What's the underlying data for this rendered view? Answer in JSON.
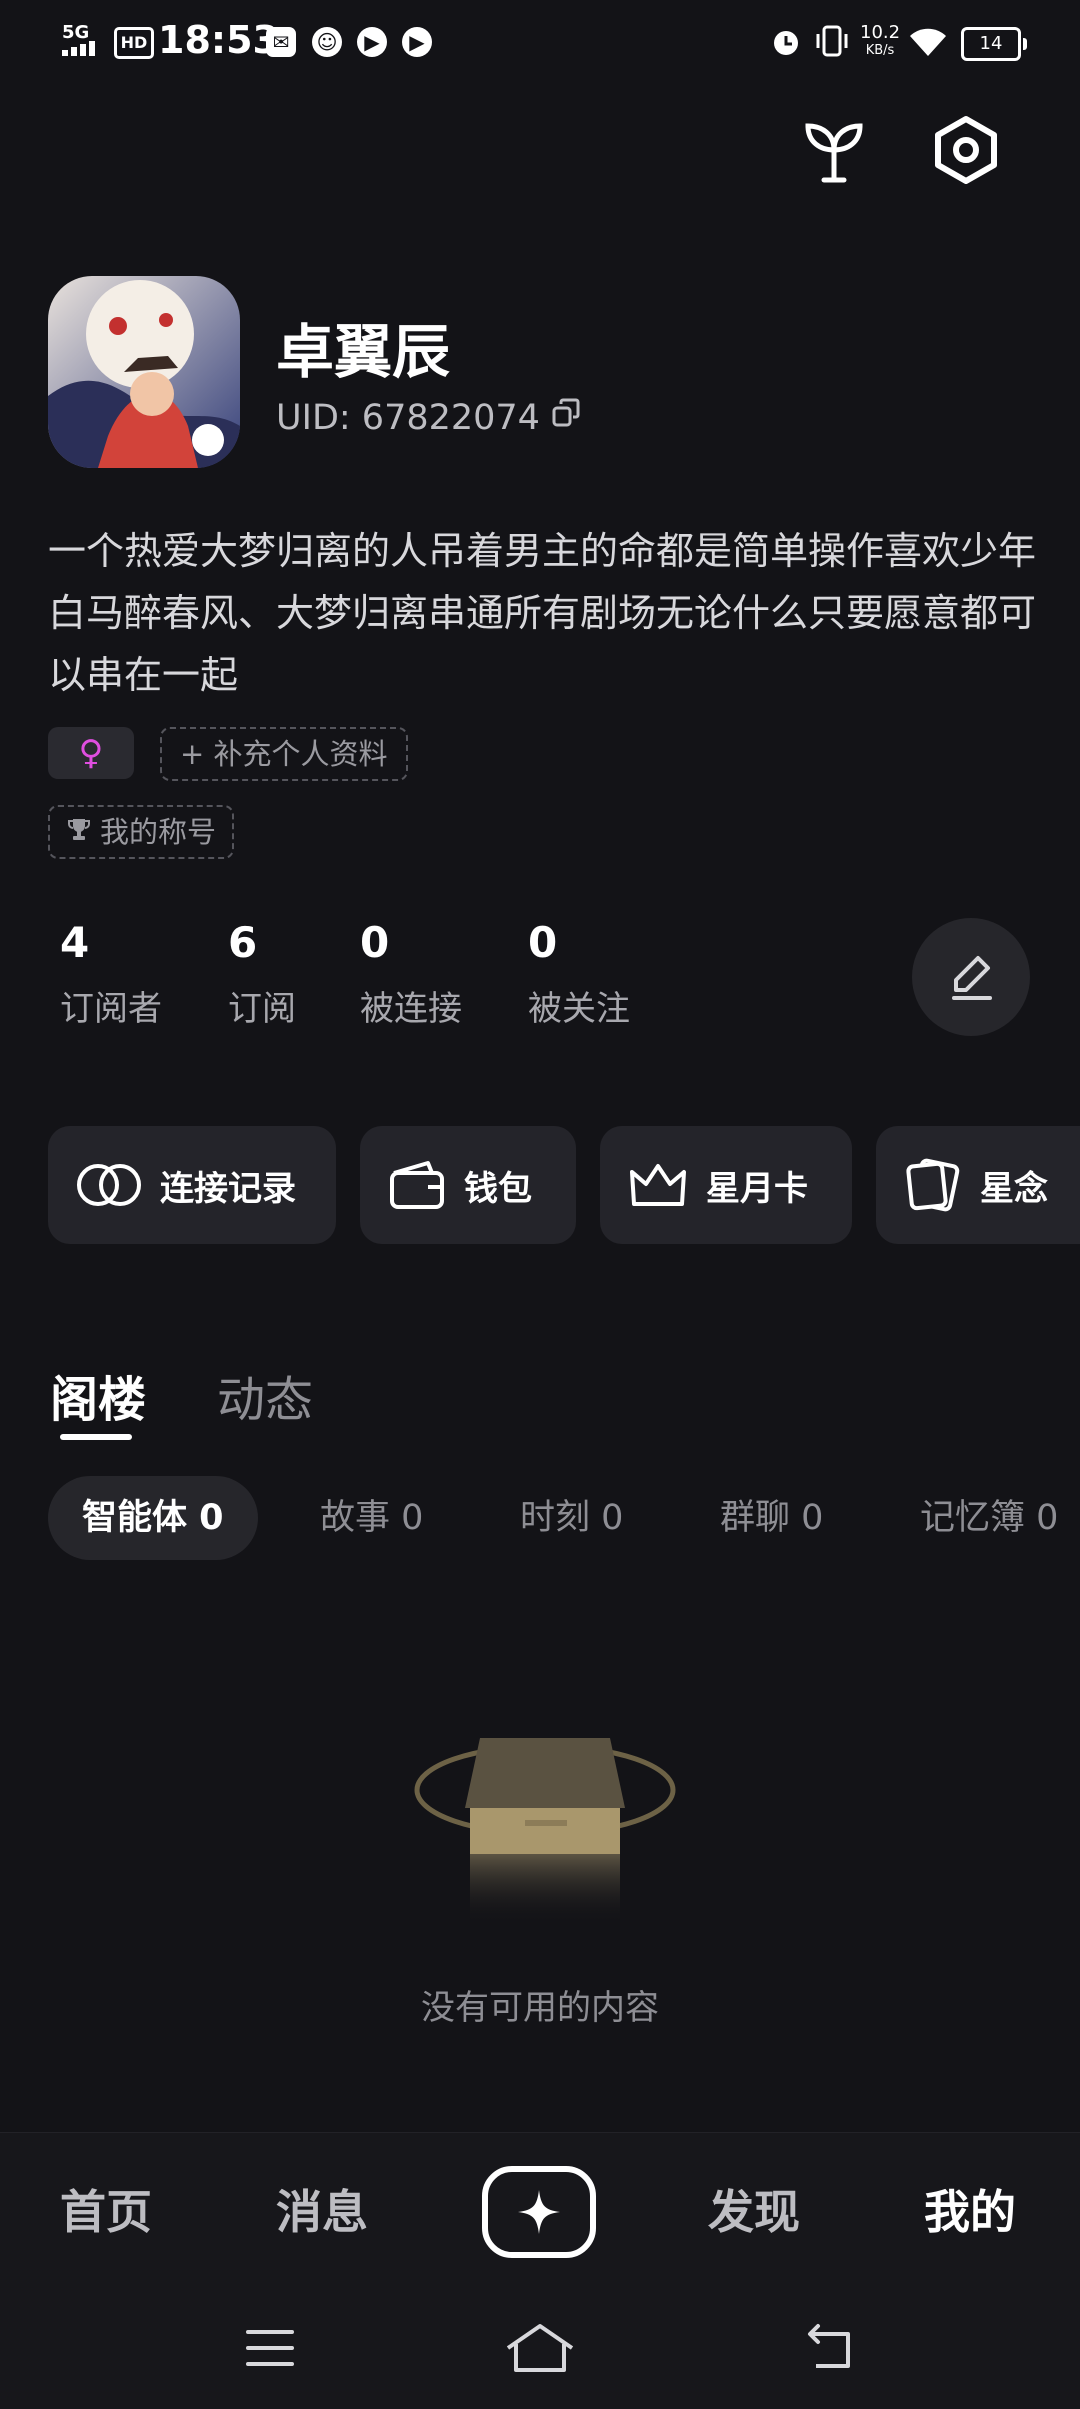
{
  "status": {
    "network": "5G",
    "hd": "HD",
    "time": "18:53",
    "speed_value": "10.2",
    "speed_unit": "KB/s",
    "battery": "14"
  },
  "profile": {
    "name": "卓翼辰",
    "uid": "UID: 67822074",
    "bio": "一个热爱大梦归离的人吊着男主的命都是简单操作喜欢少年白马醉春风、大梦归离串通所有剧场无论什么只要愿意都可以串在一起",
    "gender_symbol": "♀",
    "add_profile": "+ 补充个人资料",
    "title_chip": "我的称号"
  },
  "stats": [
    {
      "num": "4",
      "label": "订阅者"
    },
    {
      "num": "6",
      "label": "订阅"
    },
    {
      "num": "0",
      "label": "被连接"
    },
    {
      "num": "0",
      "label": "被关注"
    }
  ],
  "actions": [
    {
      "label": "连接记录",
      "icon": "rings-icon"
    },
    {
      "label": "钱包",
      "icon": "wallet-icon"
    },
    {
      "label": "星月卡",
      "icon": "crown-icon"
    },
    {
      "label": "星念",
      "icon": "cards-icon"
    }
  ],
  "tabs": {
    "active": "阁楼",
    "other": "动态"
  },
  "subtabs": [
    "智能体 0",
    "故事 0",
    "时刻 0",
    "群聊 0",
    "记忆簿 0"
  ],
  "empty_text": "没有可用的内容",
  "nav": {
    "home": "首页",
    "messages": "消息",
    "discover": "发现",
    "me": "我的"
  },
  "colors": {
    "background": "#131317",
    "gender": "#e04ee0",
    "card": "#24242a"
  }
}
